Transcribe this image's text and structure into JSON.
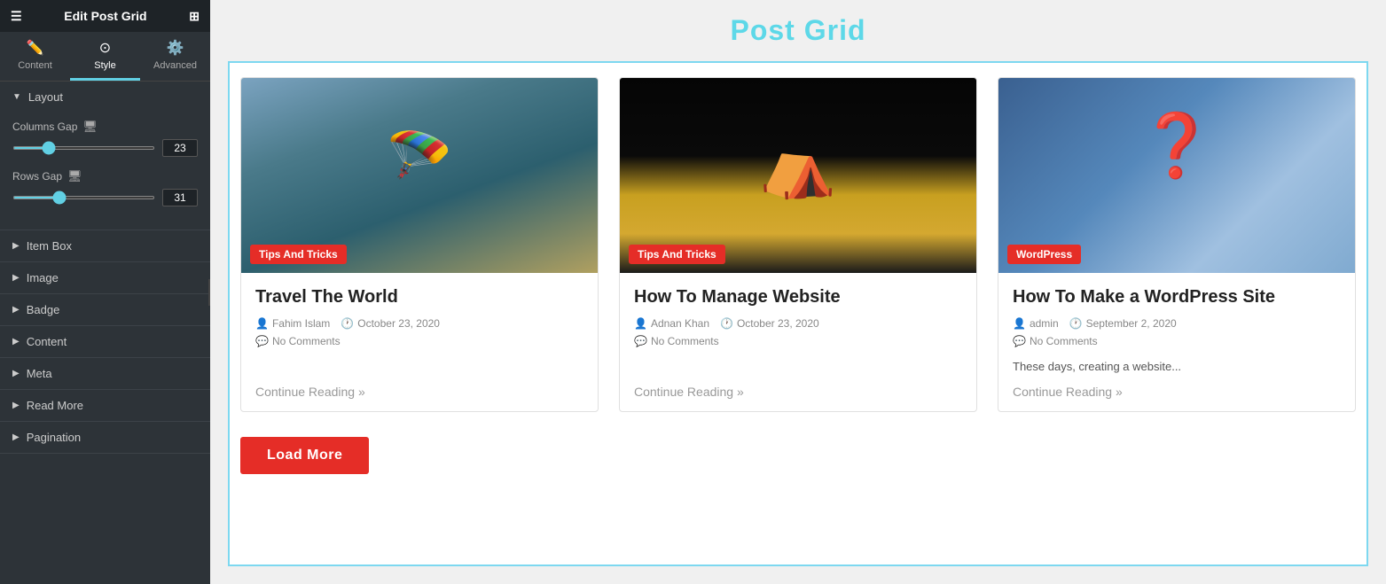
{
  "sidebar": {
    "title": "Edit Post Grid",
    "tabs": [
      {
        "id": "content",
        "label": "Content",
        "icon": "✏️"
      },
      {
        "id": "style",
        "label": "Style",
        "icon": "⚙️",
        "active": true
      },
      {
        "id": "advanced",
        "label": "Advanced",
        "icon": "⚙️"
      }
    ],
    "sections": [
      {
        "id": "layout",
        "label": "Layout",
        "open": true,
        "controls": [
          {
            "id": "columns-gap",
            "label": "Columns Gap",
            "hasMonitor": true,
            "value": 23,
            "min": 0,
            "max": 100
          },
          {
            "id": "rows-gap",
            "label": "Rows Gap",
            "hasMonitor": true,
            "value": 31,
            "min": 0,
            "max": 100
          }
        ]
      },
      {
        "id": "item-box",
        "label": "Item Box",
        "open": false
      },
      {
        "id": "image",
        "label": "Image",
        "open": false
      },
      {
        "id": "badge",
        "label": "Badge",
        "open": false
      },
      {
        "id": "content",
        "label": "Content",
        "open": false
      },
      {
        "id": "meta",
        "label": "Meta",
        "open": false
      },
      {
        "id": "read-more",
        "label": "Read More",
        "open": false
      },
      {
        "id": "pagination",
        "label": "Pagination",
        "open": false
      }
    ]
  },
  "main": {
    "title": "Post Grid",
    "posts": [
      {
        "id": 1,
        "title": "Travel The World",
        "badge": "Tips And Tricks",
        "badge_class": "badge-tips",
        "author": "Fahim Islam",
        "date": "October 23, 2020",
        "comments": "No Comments",
        "excerpt": "",
        "continue_reading": "Continue Reading »",
        "image_class": "img-skydiving"
      },
      {
        "id": 2,
        "title": "How To Manage Website",
        "badge": "Tips And Tricks",
        "badge_class": "badge-tips",
        "author": "Adnan Khan",
        "date": "October 23, 2020",
        "comments": "No Comments",
        "excerpt": "",
        "continue_reading": "Continue Reading »",
        "image_class": "img-tent"
      },
      {
        "id": 3,
        "title": "How To Make a WordPress Site",
        "badge": "WordPress",
        "badge_class": "badge-wordpress",
        "author": "admin",
        "date": "September 2, 2020",
        "comments": "No Comments",
        "excerpt": "These days, creating a website...",
        "continue_reading": "Continue Reading »",
        "image_class": "img-wordpress"
      }
    ],
    "load_more": "Load More"
  }
}
